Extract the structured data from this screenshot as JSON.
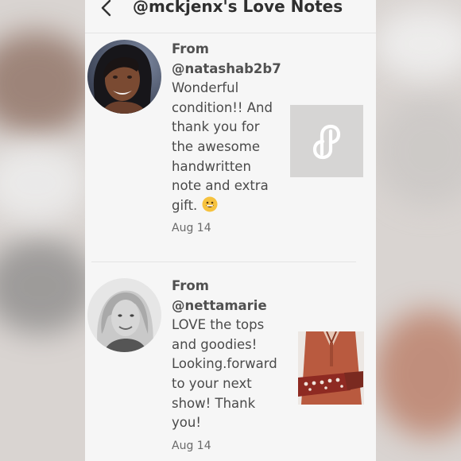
{
  "header": {
    "title": "@mckjenx's Love Notes",
    "back_icon": "chevron-left-icon"
  },
  "notes": [
    {
      "from_label": "From",
      "username": "@natashab2b7",
      "message": "Wonderful condition!! And thank you for the awesome handwritten note and extra gift.",
      "emoji": "grinning-face-emoji",
      "date": "Aug 14",
      "thumbnail": "poshmark-logo-placeholder"
    },
    {
      "from_label": "From",
      "username": "@nettamarie",
      "message": "LOVE the tops and goodies! Looking.forward to your next show! Thank you!",
      "date": "Aug 14",
      "thumbnail": "rust-sweater-photo"
    }
  ],
  "colors": {
    "panel_bg": "#f6f6f6",
    "placeholder_bg": "#d6d5d4",
    "text": "#4a4a4a"
  }
}
